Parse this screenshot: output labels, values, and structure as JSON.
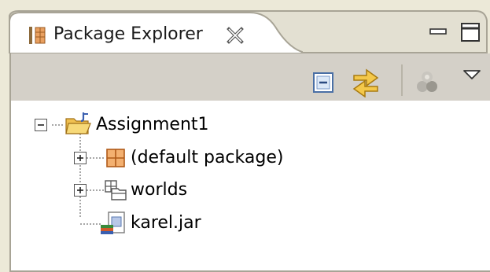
{
  "view": {
    "tab_title": "Package Explorer",
    "tab_icon": "package-explorer-icon",
    "close_icon": "close-x-icon",
    "minimize_icon": "minimize-icon",
    "maximize_icon": "maximize-icon"
  },
  "toolbar": {
    "collapse_all_icon": "collapse-all-icon",
    "link_with_editor_icon": "link-with-editor-icon",
    "filter_icon": "filter-icon",
    "view_menu_icon": "view-menu-chevron-icon"
  },
  "tree": {
    "project": {
      "label": "Assignment1",
      "icon": "java-project-folder-icon",
      "expanded": true
    },
    "children": [
      {
        "label": "(default package)",
        "icon": "package-icon",
        "expandable": true
      },
      {
        "label": "worlds",
        "icon": "folder-package-icon",
        "expandable": true
      },
      {
        "label": "karel.jar",
        "icon": "jar-icon",
        "expandable": false
      }
    ]
  },
  "colors": {
    "tab_bg": "#ffffff",
    "toolbar_bg": "#d4d0c8",
    "frame_bg": "#e8e5d6",
    "border": "#a8a496"
  }
}
